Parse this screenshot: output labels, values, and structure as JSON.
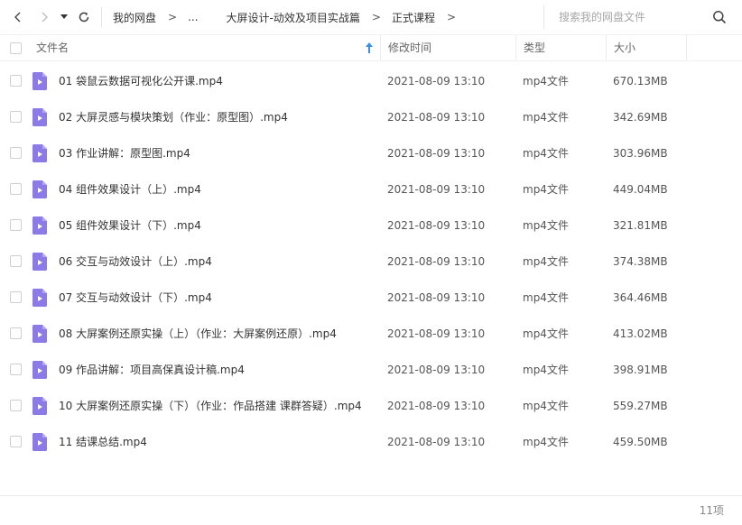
{
  "nav": {
    "back_icon": "chevron-left-icon",
    "forward_icon": "chevron-right-icon",
    "dropdown_icon": "caret-down-icon",
    "refresh_icon": "refresh-icon"
  },
  "breadcrumb": [
    {
      "label": "我的网盘"
    },
    {
      "label": "..."
    },
    {
      "label": "大屏设计-动效及项目实战篇"
    },
    {
      "label": "正式课程"
    }
  ],
  "breadcrumb_separator": ">",
  "search": {
    "placeholder": "搜索我的网盘文件",
    "value": ""
  },
  "columns": {
    "name": "文件名",
    "mtime": "修改时间",
    "type": "类型",
    "size": "大小"
  },
  "colors": {
    "file_icon": "#8c7ae6",
    "sort_arrow": "#3a8ee6",
    "header_text": "#666666"
  },
  "files": [
    {
      "name": "01 袋鼠云数据可视化公开课.mp4",
      "mtime": "2021-08-09 13:10",
      "type": "mp4文件",
      "size": "670.13MB"
    },
    {
      "name": "02 大屏灵感与模块策划（作业：原型图）.mp4",
      "mtime": "2021-08-09 13:10",
      "type": "mp4文件",
      "size": "342.69MB"
    },
    {
      "name": "03 作业讲解：原型图.mp4",
      "mtime": "2021-08-09 13:10",
      "type": "mp4文件",
      "size": "303.96MB"
    },
    {
      "name": "04 组件效果设计（上）.mp4",
      "mtime": "2021-08-09 13:10",
      "type": "mp4文件",
      "size": "449.04MB"
    },
    {
      "name": "05 组件效果设计（下）.mp4",
      "mtime": "2021-08-09 13:10",
      "type": "mp4文件",
      "size": "321.81MB"
    },
    {
      "name": "06 交互与动效设计（上）.mp4",
      "mtime": "2021-08-09 13:10",
      "type": "mp4文件",
      "size": "374.38MB"
    },
    {
      "name": "07 交互与动效设计（下）.mp4",
      "mtime": "2021-08-09 13:10",
      "type": "mp4文件",
      "size": "364.46MB"
    },
    {
      "name": "08 大屏案例还原实操（上）（作业：大屏案例还原）.mp4",
      "mtime": "2021-08-09 13:10",
      "type": "mp4文件",
      "size": "413.02MB"
    },
    {
      "name": "09 作品讲解：项目高保真设计稿.mp4",
      "mtime": "2021-08-09 13:10",
      "type": "mp4文件",
      "size": "398.91MB"
    },
    {
      "name": "10 大屏案例还原实操（下）（作业：作品搭建 课群答疑）.mp4",
      "mtime": "2021-08-09 13:10",
      "type": "mp4文件",
      "size": "559.27MB"
    },
    {
      "name": "11 结课总结.mp4",
      "mtime": "2021-08-09 13:10",
      "type": "mp4文件",
      "size": "459.50MB"
    }
  ],
  "footer": {
    "count": "11项"
  }
}
